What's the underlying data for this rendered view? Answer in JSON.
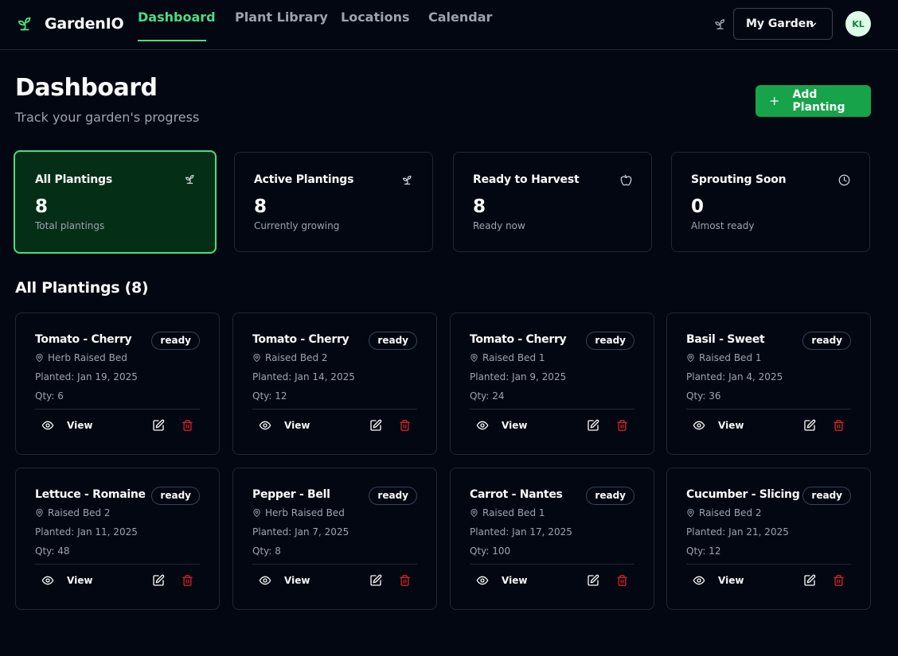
{
  "app": {
    "name": "GardenIO"
  },
  "nav": {
    "tabs": [
      {
        "label": "Dashboard",
        "active": true
      },
      {
        "label": "Plant Library",
        "active": false
      },
      {
        "label": "Locations",
        "active": false
      },
      {
        "label": "Calendar",
        "active": false
      }
    ],
    "garden_select": "My Garden",
    "avatar_initials": "KL"
  },
  "page": {
    "title": "Dashboard",
    "subtitle": "Track your garden's progress",
    "add_button": "Add Planting"
  },
  "stats": [
    {
      "label": "All Plantings",
      "value": "8",
      "sub": "Total plantings",
      "icon": "sprout-icon",
      "active": true
    },
    {
      "label": "Active Plantings",
      "value": "8",
      "sub": "Currently growing",
      "icon": "sprout-icon",
      "active": false
    },
    {
      "label": "Ready to Harvest",
      "value": "8",
      "sub": "Ready now",
      "icon": "apple-icon",
      "active": false
    },
    {
      "label": "Sprouting Soon",
      "value": "0",
      "sub": "Almost ready",
      "icon": "clock-icon",
      "active": false
    }
  ],
  "plantings": {
    "title": "All Plantings (8)",
    "view_label": "View",
    "items": [
      {
        "name": "Tomato - Cherry",
        "status": "ready",
        "location": "Herb Raised Bed",
        "planted": "Planted: Jan 19, 2025",
        "qty": "Qty: 6"
      },
      {
        "name": "Tomato - Cherry",
        "status": "ready",
        "location": "Raised Bed 2",
        "planted": "Planted: Jan 14, 2025",
        "qty": "Qty: 12"
      },
      {
        "name": "Tomato - Cherry",
        "status": "ready",
        "location": "Raised Bed 1",
        "planted": "Planted: Jan 9, 2025",
        "qty": "Qty: 24"
      },
      {
        "name": "Basil - Sweet",
        "status": "ready",
        "location": "Raised Bed 1",
        "planted": "Planted: Jan 4, 2025",
        "qty": "Qty: 36"
      },
      {
        "name": "Lettuce - Romaine",
        "status": "ready",
        "location": "Raised Bed 2",
        "planted": "Planted: Jan 11, 2025",
        "qty": "Qty: 48"
      },
      {
        "name": "Pepper - Bell",
        "status": "ready",
        "location": "Herb Raised Bed",
        "planted": "Planted: Jan 7, 2025",
        "qty": "Qty: 8"
      },
      {
        "name": "Carrot - Nantes",
        "status": "ready",
        "location": "Raised Bed 1",
        "planted": "Planted: Jan 17, 2025",
        "qty": "Qty: 100"
      },
      {
        "name": "Cucumber - Slicing",
        "status": "ready",
        "location": "Raised Bed 2",
        "planted": "Planted: Jan 21, 2025",
        "qty": "Qty: 12"
      }
    ]
  },
  "colors": {
    "background": "#030712",
    "accent": "#4ade80",
    "primary_button": "#16a34a",
    "danger": "#dc2626",
    "border": "#1f2937",
    "muted_text": "#9ca3af"
  }
}
